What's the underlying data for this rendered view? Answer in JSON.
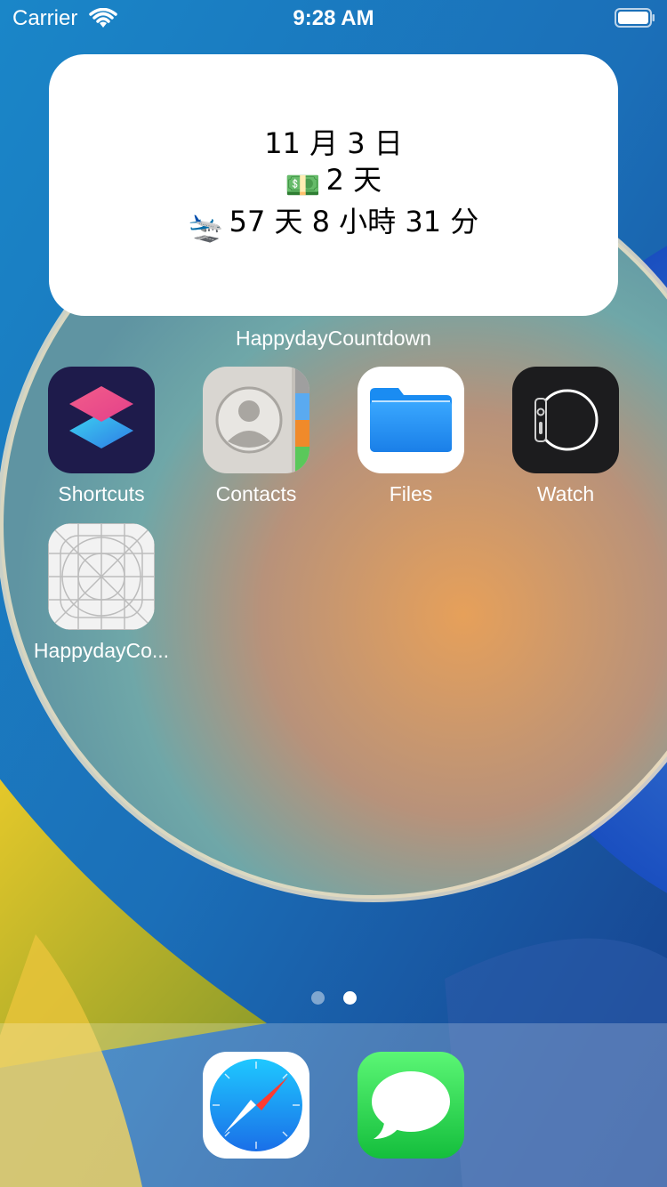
{
  "status_bar": {
    "carrier": "Carrier",
    "time": "9:28 AM",
    "wifi_icon": "wifi-icon",
    "battery_icon": "battery-icon"
  },
  "widget": {
    "line_date": "11 月 3 日",
    "line_money_emoji": "💵",
    "line_money": "2 天",
    "line_flight_emoji": "🛬",
    "line_flight": "57 天 8 小時 31 分",
    "label": "HappydayCountdown"
  },
  "apps": [
    {
      "label": "Shortcuts",
      "icon": "shortcuts-icon"
    },
    {
      "label": "Contacts",
      "icon": "contacts-icon"
    },
    {
      "label": "Files",
      "icon": "files-icon"
    },
    {
      "label": "Watch",
      "icon": "watch-icon"
    },
    {
      "label": "HappydayCo...",
      "icon": "placeholder-app-icon"
    }
  ],
  "page_indicator": {
    "pages": 2,
    "current": 2
  },
  "dock": [
    {
      "icon": "safari-icon"
    },
    {
      "icon": "messages-icon"
    }
  ],
  "colors": {
    "shortcuts_bg": "#1e1b4b",
    "files_blue": "#1a8cf2",
    "watch_bg": "#1c1c1e",
    "messages_green": "#32c759"
  }
}
